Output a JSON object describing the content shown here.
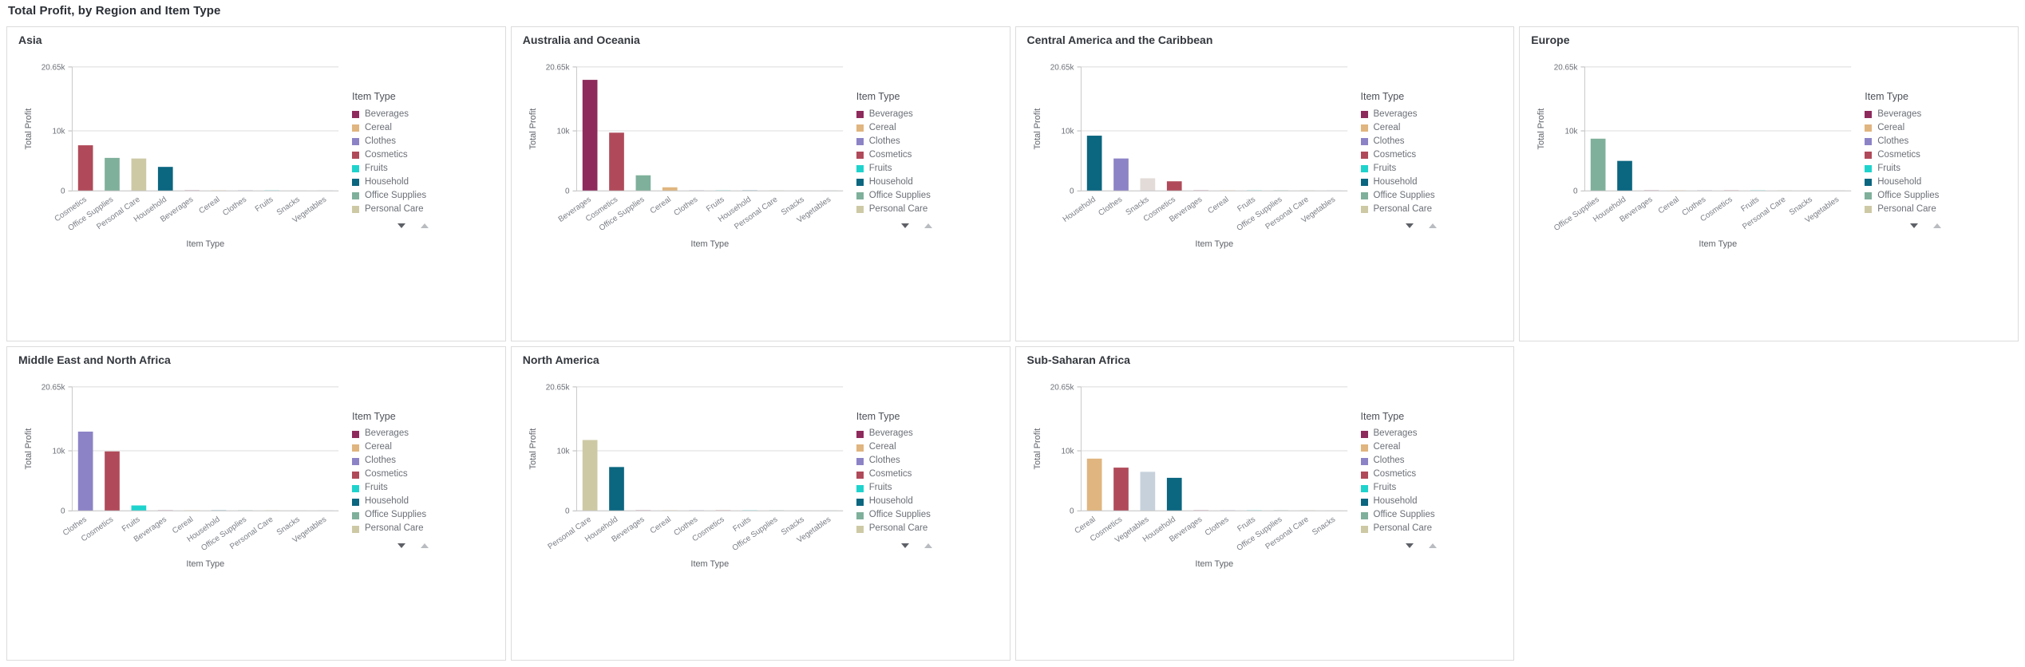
{
  "page": {
    "title": "Total Profit, by Region and Item Type"
  },
  "legend": {
    "title": "Item Type",
    "items": [
      {
        "label": "Beverages",
        "color": "#8e2a5c"
      },
      {
        "label": "Cereal",
        "color": "#e0b57f"
      },
      {
        "label": "Clothes",
        "color": "#8c83c6"
      },
      {
        "label": "Cosmetics",
        "color": "#b04a5a"
      },
      {
        "label": "Fruits",
        "color": "#1fd3cd"
      },
      {
        "label": "Household",
        "color": "#0b6680"
      },
      {
        "label": "Office Supplies",
        "color": "#7fb09b"
      },
      {
        "label": "Personal Care",
        "color": "#cdc9a5"
      }
    ],
    "nav": {
      "down_label": "scroll-down",
      "up_label": "scroll-up"
    }
  },
  "extra_colors": {
    "Snacks": "#e2dbd7",
    "Vegetables": "#c6d1dc"
  },
  "axis": {
    "y_label": "Total Profit",
    "x_label": "Item Type",
    "y_ticks": [
      "20.65k",
      "10k",
      "0"
    ],
    "y_tick_values": [
      20650,
      10000,
      0
    ],
    "ylim": [
      0,
      20650
    ]
  },
  "chart_data": [
    {
      "type": "bar",
      "title": "Asia",
      "xlabel": "Item Type",
      "ylabel": "Total Profit",
      "ylim": [
        0,
        20650
      ],
      "grid": true,
      "legend_position": "right",
      "categories": [
        "Cosmetics",
        "Office Supplies",
        "Personal Care",
        "Household",
        "Beverages",
        "Cereal",
        "Clothes",
        "Fruits",
        "Snacks",
        "Vegetables"
      ],
      "values": [
        7600,
        5500,
        5400,
        4000,
        60,
        20,
        15,
        40,
        10,
        8
      ],
      "colors": [
        "#b04a5a",
        "#7fb09b",
        "#cdc9a5",
        "#0b6680",
        "#8e2a5c",
        "#e0b57f",
        "#8c83c6",
        "#1fd3cd",
        "#e2dbd7",
        "#c6d1dc"
      ]
    },
    {
      "type": "bar",
      "title": "Australia and Oceania",
      "xlabel": "Item Type",
      "ylabel": "Total Profit",
      "ylim": [
        0,
        20650
      ],
      "grid": true,
      "legend_position": "right",
      "categories": [
        "Beverages",
        "Cosmetics",
        "Office Supplies",
        "Cereal",
        "Clothes",
        "Fruits",
        "Household",
        "Personal Care",
        "Snacks",
        "Vegetables"
      ],
      "values": [
        18500,
        9700,
        2600,
        600,
        30,
        60,
        55,
        20,
        10,
        8
      ],
      "colors": [
        "#8e2a5c",
        "#b04a5a",
        "#7fb09b",
        "#e0b57f",
        "#8c83c6",
        "#1fd3cd",
        "#0b6680",
        "#cdc9a5",
        "#e2dbd7",
        "#c6d1dc"
      ]
    },
    {
      "type": "bar",
      "title": "Central America and the Caribbean",
      "xlabel": "Item Type",
      "ylabel": "Total Profit",
      "ylim": [
        0,
        20650
      ],
      "grid": true,
      "legend_position": "right",
      "categories": [
        "Household",
        "Clothes",
        "Snacks",
        "Cosmetics",
        "Beverages",
        "Cereal",
        "Fruits",
        "Office Supplies",
        "Personal Care",
        "Vegetables"
      ],
      "values": [
        9200,
        5400,
        2100,
        1600,
        50,
        25,
        60,
        15,
        10,
        8
      ],
      "colors": [
        "#0b6680",
        "#8c83c6",
        "#e2dbd7",
        "#b04a5a",
        "#8e2a5c",
        "#e0b57f",
        "#1fd3cd",
        "#7fb09b",
        "#cdc9a5",
        "#c6d1dc"
      ]
    },
    {
      "type": "bar",
      "title": "Europe",
      "xlabel": "Item Type",
      "ylabel": "Total Profit",
      "ylim": [
        0,
        20650
      ],
      "grid": true,
      "legend_position": "right",
      "categories": [
        "Office Supplies",
        "Household",
        "Beverages",
        "Cereal",
        "Clothes",
        "Cosmetics",
        "Fruits",
        "Personal Care",
        "Snacks",
        "Vegetables"
      ],
      "values": [
        8700,
        5000,
        50,
        30,
        25,
        20,
        70,
        15,
        10,
        8
      ],
      "colors": [
        "#7fb09b",
        "#0b6680",
        "#8e2a5c",
        "#e0b57f",
        "#8c83c6",
        "#b04a5a",
        "#1fd3cd",
        "#cdc9a5",
        "#e2dbd7",
        "#c6d1dc"
      ]
    },
    {
      "type": "bar",
      "title": "Middle East and North Africa",
      "xlabel": "Item Type",
      "ylabel": "Total Profit",
      "ylim": [
        0,
        20650
      ],
      "grid": true,
      "legend_position": "right",
      "categories": [
        "Clothes",
        "Cosmetics",
        "Fruits",
        "Beverages",
        "Cereal",
        "Household",
        "Office Supplies",
        "Personal Care",
        "Snacks",
        "Vegetables"
      ],
      "values": [
        13200,
        9900,
        900,
        60,
        30,
        50,
        20,
        15,
        10,
        8
      ],
      "colors": [
        "#8c83c6",
        "#b04a5a",
        "#1fd3cd",
        "#8e2a5c",
        "#e0b57f",
        "#0b6680",
        "#7fb09b",
        "#cdc9a5",
        "#e2dbd7",
        "#c6d1dc"
      ]
    },
    {
      "type": "bar",
      "title": "North America",
      "xlabel": "Item Type",
      "ylabel": "Total Profit",
      "ylim": [
        0,
        20650
      ],
      "grid": true,
      "legend_position": "right",
      "categories": [
        "Personal Care",
        "Household",
        "Beverages",
        "Cereal",
        "Clothes",
        "Cosmetics",
        "Fruits",
        "Office Supplies",
        "Snacks",
        "Vegetables"
      ],
      "values": [
        11800,
        7300,
        50,
        25,
        20,
        30,
        60,
        15,
        10,
        8
      ],
      "colors": [
        "#cdc9a5",
        "#0b6680",
        "#8e2a5c",
        "#e0b57f",
        "#8c83c6",
        "#b04a5a",
        "#1fd3cd",
        "#7fb09b",
        "#e2dbd7",
        "#c6d1dc"
      ]
    },
    {
      "type": "bar",
      "title": "Sub-Saharan Africa",
      "xlabel": "Item Type",
      "ylabel": "Total Profit",
      "ylim": [
        0,
        20650
      ],
      "grid": true,
      "legend_position": "right",
      "categories": [
        "Cereal",
        "Cosmetics",
        "Vegetables",
        "Household",
        "Beverages",
        "Clothes",
        "Fruits",
        "Office Supplies",
        "Personal Care",
        "Snacks"
      ],
      "values": [
        8700,
        7200,
        6500,
        5500,
        55,
        30,
        60,
        20,
        15,
        10
      ],
      "colors": [
        "#e0b57f",
        "#b04a5a",
        "#c6d1dc",
        "#0b6680",
        "#8e2a5c",
        "#8c83c6",
        "#1fd3cd",
        "#7fb09b",
        "#cdc9a5",
        "#e2dbd7"
      ]
    }
  ]
}
